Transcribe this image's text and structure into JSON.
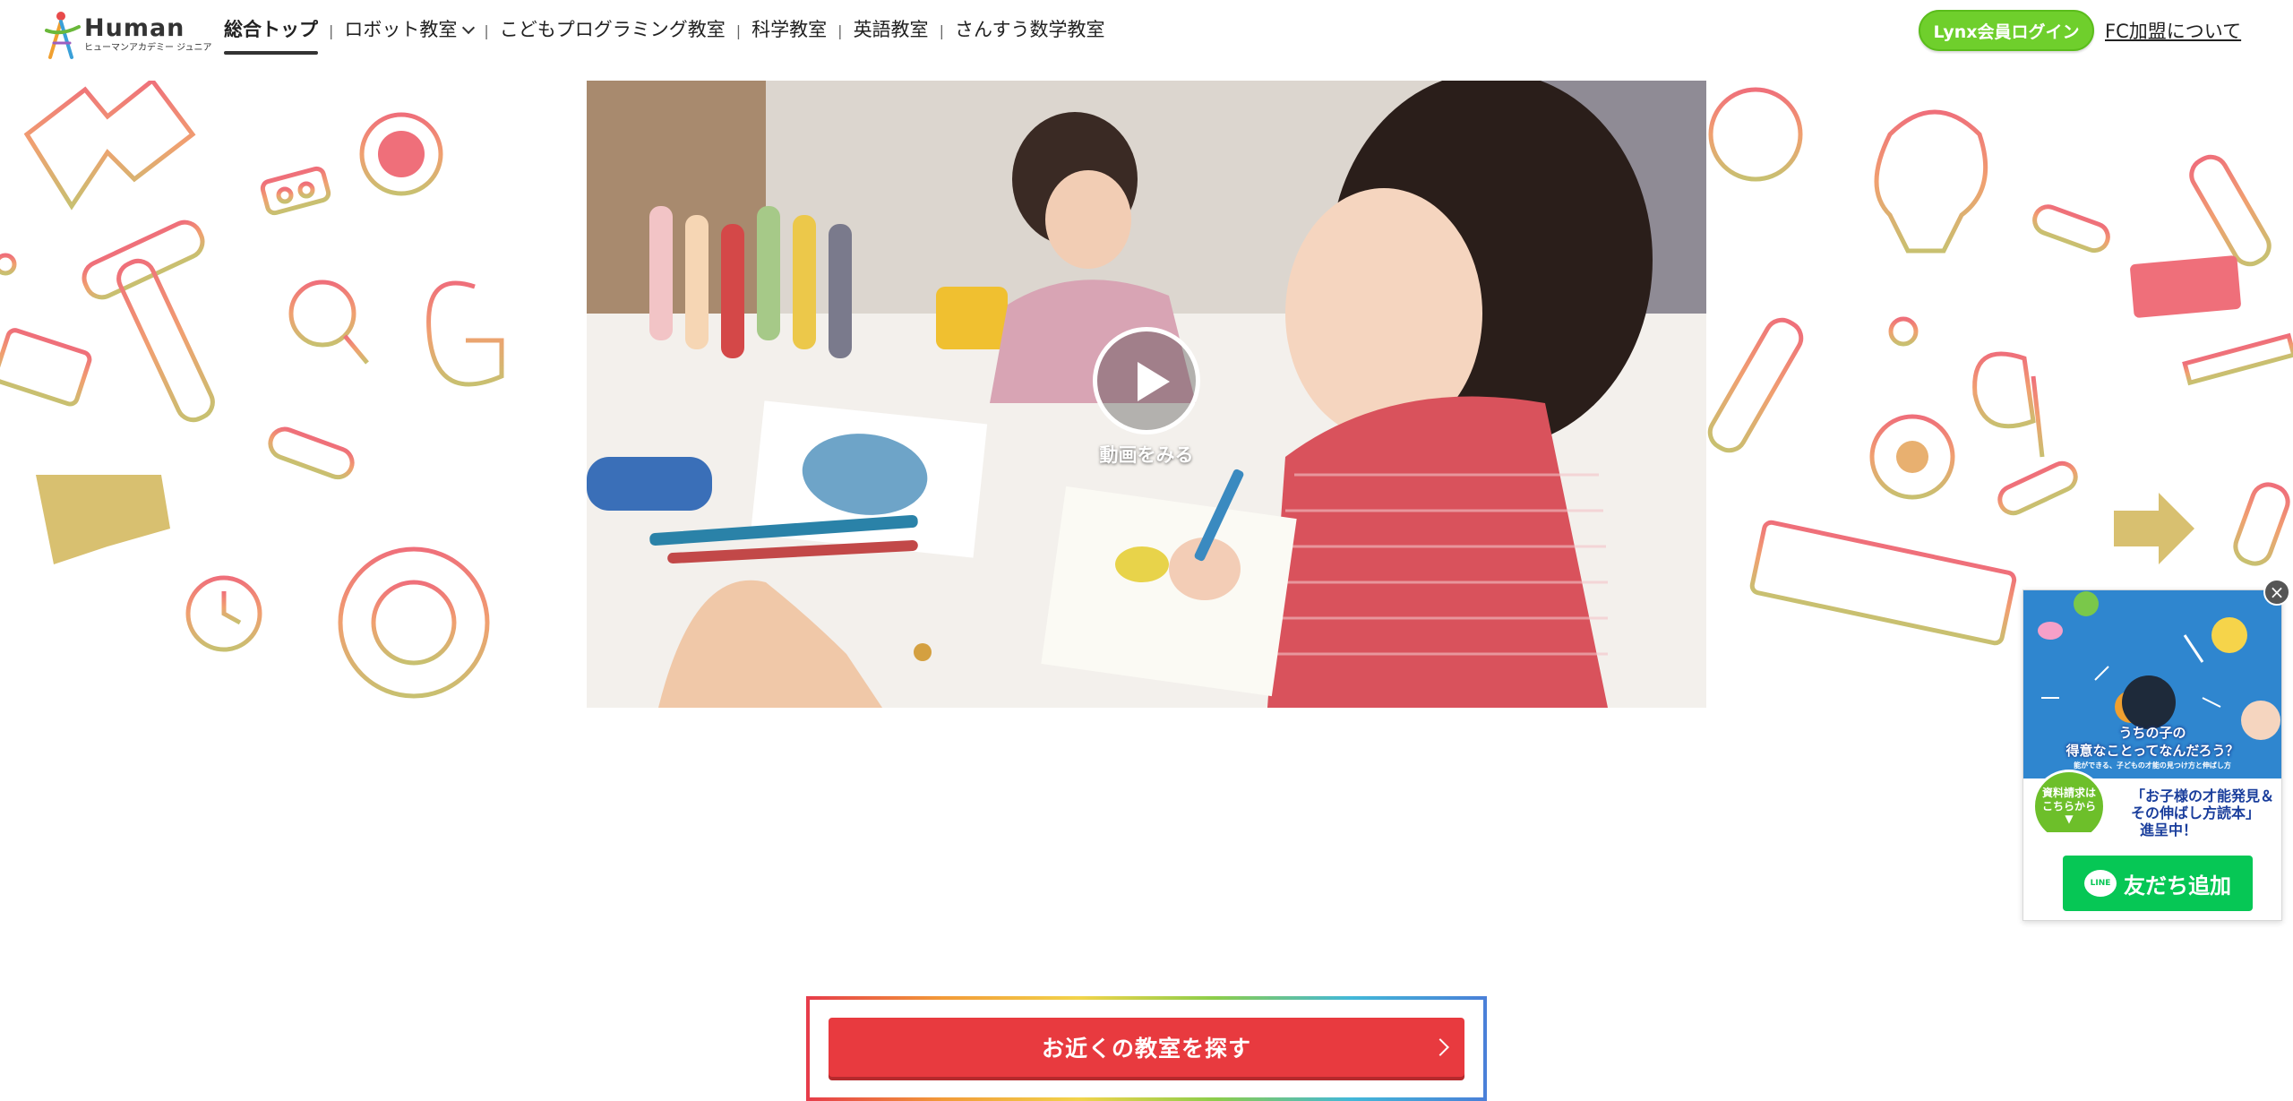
{
  "header": {
    "logo_word": "Human",
    "logo_sub": "ヒューマンアカデミー ジュニア",
    "nav": [
      {
        "label": "総合トップ"
      },
      {
        "label": "ロボット教室"
      },
      {
        "label": "こどもプログラミング教室"
      },
      {
        "label": "科学教室"
      },
      {
        "label": "英語教室"
      },
      {
        "label": "さんすう数学教室"
      }
    ],
    "login_label": "Lynx会員ログイン",
    "fc_label": "FC加盟について"
  },
  "hero": {
    "play_label": "動画をみる"
  },
  "cta": {
    "label": "お近くの教室を探す"
  },
  "banner": {
    "headline_1": "うちの子の",
    "headline_2": "得意なことってなんだろう？",
    "caption": "能ができる、子どもの才能の見つけ方と伸ばし方",
    "badge_1": "資料請求は",
    "badge_2": "こちらから",
    "pitch_1": "「お子様の才能発見＆",
    "pitch_2": "その伸ばし方読本」",
    "pitch_3": "進呈中！",
    "line_logo": "LINE",
    "line_label": "友だち追加",
    "close_label": "×"
  },
  "colors": {
    "accent_green": "#6fcf2c",
    "cta_red": "#e83a3f",
    "line_green": "#06c755"
  }
}
